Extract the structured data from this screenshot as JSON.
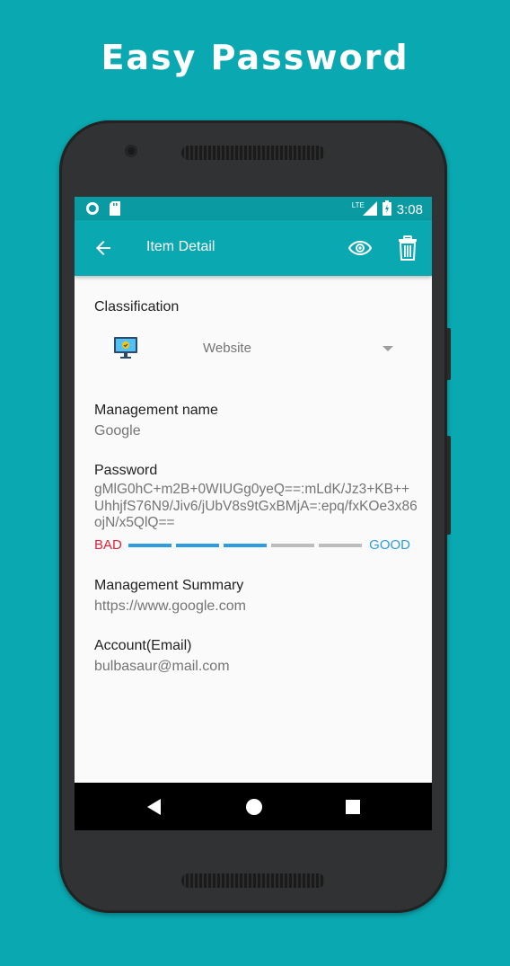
{
  "promo": {
    "title": "Easy Password"
  },
  "status_bar": {
    "network": "LTE",
    "time": "3:08"
  },
  "app_bar": {
    "title": "Item Detail"
  },
  "classification": {
    "label": "Classification",
    "selected": "Website"
  },
  "management_name": {
    "label": "Management name",
    "value": "Google"
  },
  "password": {
    "label": "Password",
    "value": "gMlG0hC+m2B+0WIUGg0yeQ==:mLdK/Jz3+KB++UhhjfS76N9/Jiv6/jUbV8s9tGxBMjA=:epq/fxKOe3x86ojN/x5QlQ==",
    "strength_bad_label": "BAD",
    "strength_good_label": "GOOD",
    "strength_level": 0.6
  },
  "management_summary": {
    "label": "Management Summary",
    "value": "https://www.google.com"
  },
  "account": {
    "label": "Account(Email)",
    "value": "bulbasaur@mail.com"
  },
  "colors": {
    "accent": "#0aa9b1",
    "bad": "#e0223a",
    "good": "#2d9de0",
    "strength_on": "#2d9de0",
    "strength_off": "#bdbdbd"
  },
  "icons": {
    "back": "arrow-back-icon",
    "eye": "eye-icon",
    "trash": "trash-icon",
    "classification": "monitor-icon",
    "fab": "edit-note-icon"
  }
}
